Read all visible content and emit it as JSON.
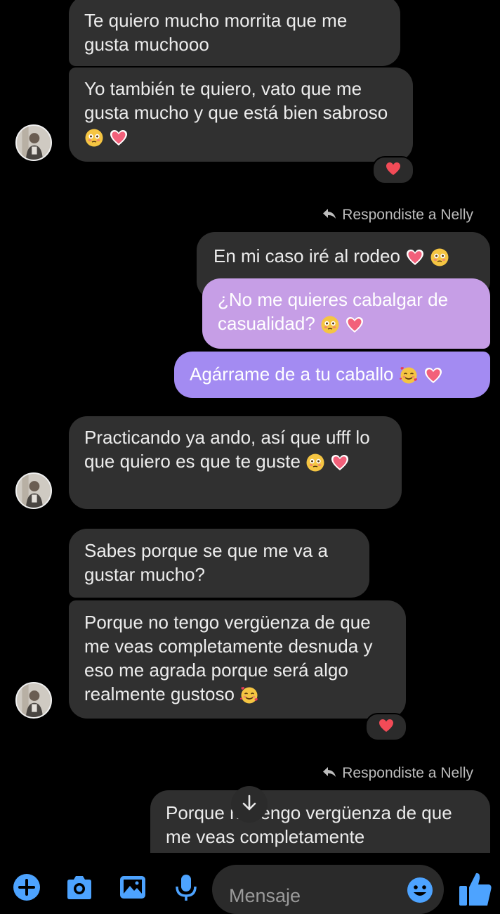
{
  "colors": {
    "background": "#000000",
    "incoming_bubble": "#303030",
    "outgoing_pink": "#c69ee6",
    "outgoing_violet": "#a38bf2",
    "accent_blue": "#4da3ff"
  },
  "messages": [
    {
      "text": "Te quiero mucho morrita que me gusta muchooo",
      "emoji": ""
    },
    {
      "text": "Yo también te quiero, vato que me gusta mucho y que está bien sabroso",
      "emoji": "flushed, heart"
    },
    {
      "text": "En mi caso iré al rodeo",
      "emoji": "heart, flushed"
    },
    {
      "text": "¿No me quieres cabalgar de casualidad?",
      "emoji": "flushed, heart"
    },
    {
      "text": "Agárrame de a tu caballo",
      "emoji": "smiling-hearts, heart"
    },
    {
      "text": "Practicando ya ando, así que ufff lo que quiero es que te guste",
      "emoji": "flushed, heart"
    },
    {
      "text": "Sabes porque se que me va a gustar mucho?",
      "emoji": ""
    },
    {
      "text": "Porque no tengo vergüenza de que me veas completamente desnuda y eso me agrada porque será algo realmente gustoso",
      "emoji": "smiling-hearts"
    },
    {
      "text": "Porque no tengo vergüenza de que me veas completamente",
      "emoji": ""
    }
  ],
  "reply_notices": [
    {
      "text": "Respondiste a Nelly"
    },
    {
      "text": "Respondiste a Nelly"
    }
  ],
  "reactions": [
    {
      "icon": "heart-icon"
    },
    {
      "icon": "heart-icon"
    }
  ],
  "composer": {
    "placeholder": "Mensaje",
    "tools": [
      "plus-icon",
      "camera-icon",
      "image-icon",
      "microphone-icon",
      "emoji-icon",
      "thumbs-up-icon"
    ]
  }
}
